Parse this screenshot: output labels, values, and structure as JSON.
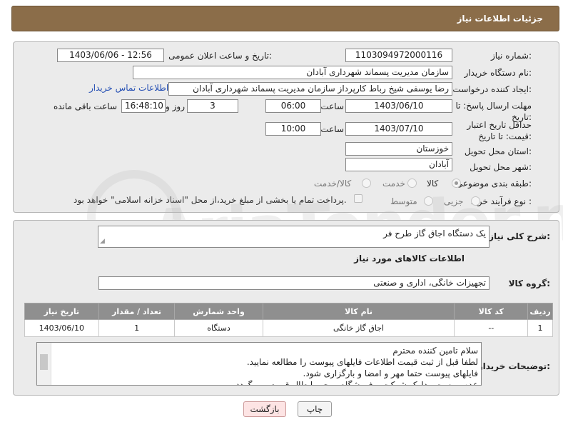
{
  "header": {
    "title": "جزئیات اطلاعات نیاز"
  },
  "form": {
    "need_number_label": "شماره نیاز:",
    "need_number": "1103094972000116",
    "announce_label": "تاریخ و ساعت اعلان عمومی:",
    "announce_value": "1403/06/06 - 12:56",
    "buyer_org_label": "نام دستگاه خریدار:",
    "buyer_org": "سازمان مدیریت پسماند شهرداری آبادان",
    "requester_label": "ایجاد کننده درخواست:",
    "requester": "رضا یوسفی شیخ رباط کارپرداز سازمان مدیریت پسماند شهرداری آبادان",
    "contact_link": "اطلاعات تماس خریدار",
    "reply_deadline_label": "مهلت ارسال پاسخ: تا تاریخ:",
    "reply_date": "1403/06/10",
    "time_label": "ساعت",
    "reply_time": "06:00",
    "days_value": "3",
    "days_label": "روز و",
    "remaining_time": "16:48:10",
    "remaining_label": "ساعت باقی مانده",
    "validity_label": "حداقل تاریخ اعتبار قیمت: تا تاریخ:",
    "validity_date": "1403/07/10",
    "validity_time": "10:00",
    "province_label": "استان محل تحویل:",
    "province": "خوزستان",
    "city_label": "شهر محل تحویل:",
    "city": "آبادان",
    "category_label": "طبقه بندی موضوعی:",
    "category_options": [
      "کالا",
      "خدمت",
      "کالا/خدمت"
    ],
    "process_label": "نوع فرآیند خرید :",
    "process_options": [
      "جزیی",
      "متوسط"
    ],
    "payment_note": "پرداخت تمام یا بخشی از مبلغ خرید،از محل \"اسناد خزانه اسلامی\" خواهد بود."
  },
  "details": {
    "summary_label": "شرح کلی نیاز:",
    "summary": "یک دستگاه اجاق گاز طرح فر",
    "goods_info_title": "اطلاعات کالاهای مورد نیاز",
    "goods_group_label": "گروه کالا:",
    "goods_group": "تجهیزات خانگی، اداری و صنعتی",
    "table": {
      "headers": [
        "ردیف",
        "کد کالا",
        "نام کالا",
        "واحد شمارش",
        "تعداد / مقدار",
        "تاریخ نیاز"
      ],
      "rows": [
        [
          "1",
          "--",
          "اجاق گاز خانگی",
          "دستگاه",
          "1",
          "1403/06/10"
        ]
      ]
    },
    "buyer_notes_label": "توضیحات خریدار:",
    "buyer_notes": [
      "سلام تامین کننده محترم",
      "لطفا قبل از ثبت قیمت اطلاعات فایلهای پیوست را مطالعه نمایید.",
      "فایلهای پیوست حتما مهر و امضا و بارگزاری شود.",
      "عدم پیوست مدارک شرکت و فروشگاه موجب ابطال قیمت می گردد."
    ]
  },
  "buttons": {
    "print": "چاپ",
    "back": "بازگشت"
  },
  "watermark": "AriaTender.neT"
}
